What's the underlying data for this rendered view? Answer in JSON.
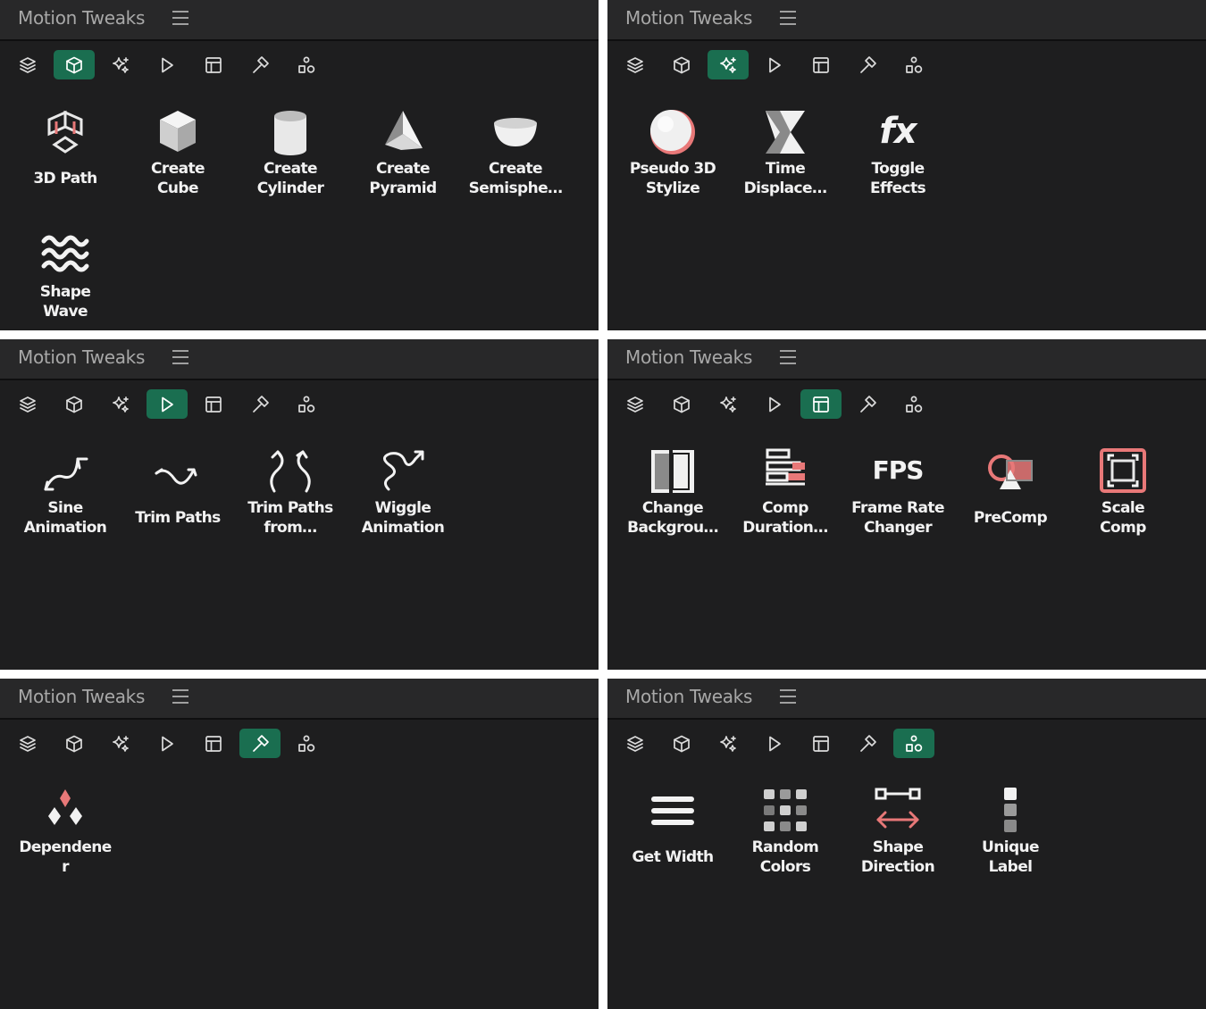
{
  "app_title": "Motion Tweaks",
  "colors": {
    "active_tab": "#1a6e50",
    "panel_bg": "#1e1e1f",
    "accent_red": "#e87878"
  },
  "toolbar": [
    "layers-icon",
    "cube-icon",
    "sparkle-icon",
    "play-icon",
    "layout-icon",
    "hammer-icon",
    "shapes-icon"
  ],
  "panels": [
    {
      "active_tool": 1,
      "tiles": [
        {
          "label": "3D Path",
          "icon": "3d-path-icon"
        },
        {
          "label": "Create\nCube",
          "icon": "cube-shape-icon"
        },
        {
          "label": "Create\nCylinder",
          "icon": "cylinder-icon"
        },
        {
          "label": "Create\nPyramid",
          "icon": "pyramid-icon"
        },
        {
          "label": "Create\nSemisphe…",
          "icon": "semisphere-icon"
        },
        {
          "label": "Shape\nWave",
          "icon": "wave-icon"
        }
      ]
    },
    {
      "active_tool": 2,
      "tiles": [
        {
          "label": "Pseudo 3D\nStylize",
          "icon": "sphere-icon"
        },
        {
          "label": "Time\nDisplace…",
          "icon": "hourglass-icon"
        },
        {
          "label": "Toggle\nEffects",
          "icon": "fx-icon",
          "icon_text": "fx"
        }
      ]
    },
    {
      "active_tool": 3,
      "tiles": [
        {
          "label": "Sine\nAnimation",
          "icon": "sine-arrow-icon"
        },
        {
          "label": "Trim Paths",
          "icon": "trim-arrow-icon"
        },
        {
          "label": "Trim Paths\nfrom…",
          "icon": "trim-from-icon"
        },
        {
          "label": "Wiggle\nAnimation",
          "icon": "wiggle-icon"
        }
      ]
    },
    {
      "active_tool": 4,
      "tiles": [
        {
          "label": "Change\nBackgrou…",
          "icon": "background-icon"
        },
        {
          "label": "Comp\nDuration…",
          "icon": "duration-icon"
        },
        {
          "label": "Frame Rate\nChanger",
          "icon": "fps-icon",
          "icon_text": "FPS"
        },
        {
          "label": "PreComp",
          "icon": "precomp-icon"
        },
        {
          "label": "Scale\nComp",
          "icon": "scale-comp-icon"
        }
      ]
    },
    {
      "active_tool": 5,
      "tiles": [
        {
          "label": "Dependene\nr",
          "icon": "dependener-icon"
        }
      ]
    },
    {
      "active_tool": 6,
      "tiles": [
        {
          "label": "Get Width",
          "icon": "width-icon"
        },
        {
          "label": "Random\nColors",
          "icon": "grid-colors-icon"
        },
        {
          "label": "Shape\nDirection",
          "icon": "direction-icon"
        },
        {
          "label": "Unique\nLabel",
          "icon": "unique-label-icon"
        }
      ]
    }
  ]
}
